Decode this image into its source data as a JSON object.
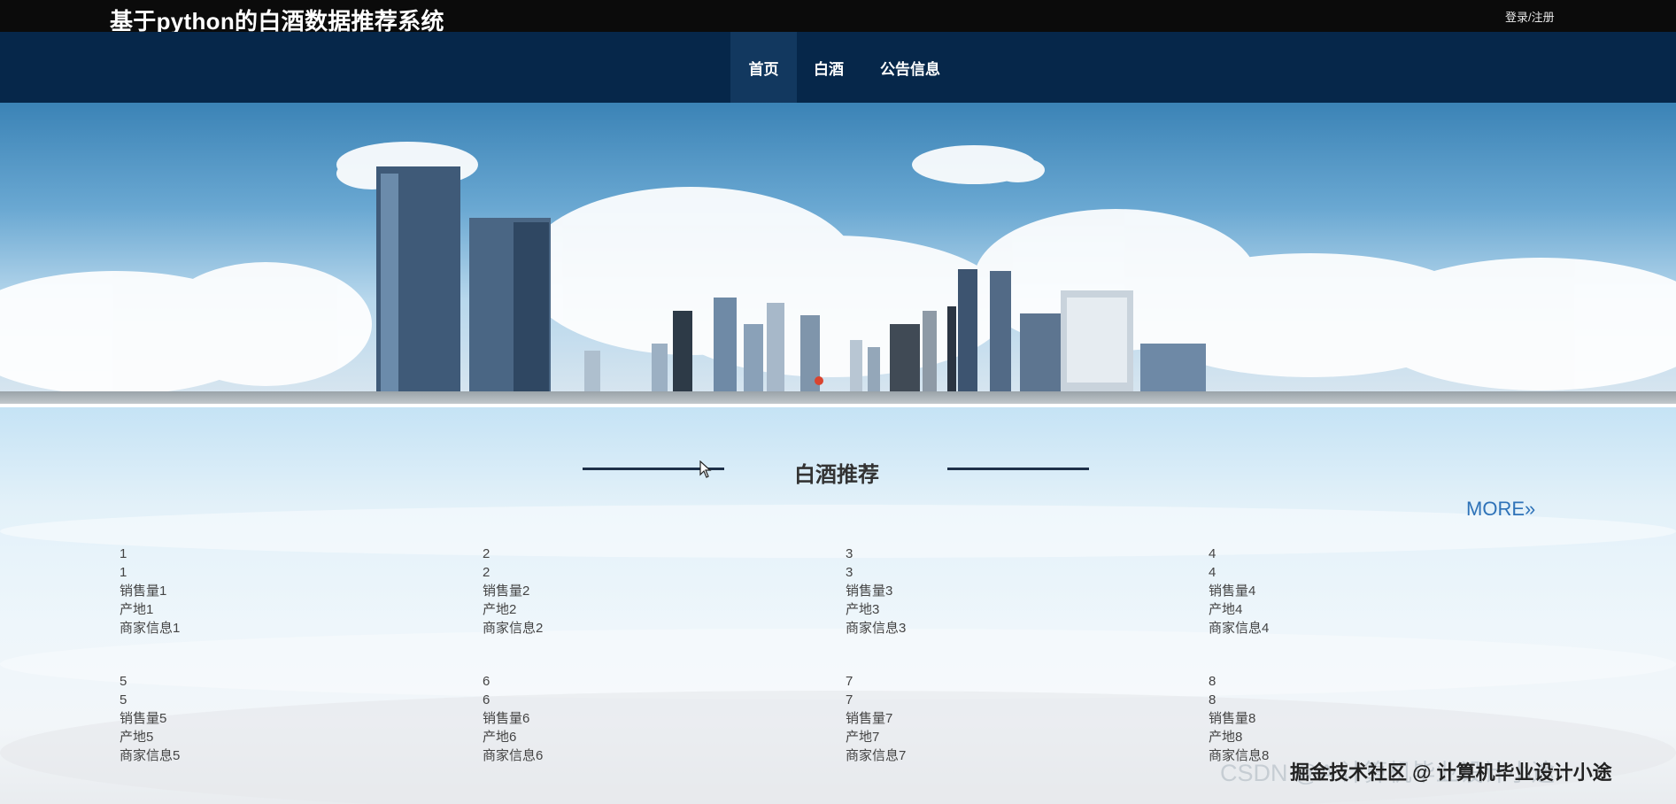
{
  "header": {
    "site_title": "基于python的白酒数据推荐系统",
    "login_link": "登录/注册"
  },
  "nav": {
    "items": [
      {
        "label": "首页",
        "active": true
      },
      {
        "label": "白酒",
        "active": false
      },
      {
        "label": "公告信息",
        "active": false
      }
    ]
  },
  "section": {
    "title": "白酒推荐",
    "more": "MORE»"
  },
  "products": [
    {
      "name": "1",
      "subtitle": "1",
      "sales": "销售量1",
      "origin": "产地1",
      "merchant": "商家信息1"
    },
    {
      "name": "2",
      "subtitle": "2",
      "sales": "销售量2",
      "origin": "产地2",
      "merchant": "商家信息2"
    },
    {
      "name": "3",
      "subtitle": "3",
      "sales": "销售量3",
      "origin": "产地3",
      "merchant": "商家信息3"
    },
    {
      "name": "4",
      "subtitle": "4",
      "sales": "销售量4",
      "origin": "产地4",
      "merchant": "商家信息4"
    },
    {
      "name": "5",
      "subtitle": "5",
      "sales": "销售量5",
      "origin": "产地5",
      "merchant": "商家信息5"
    },
    {
      "name": "6",
      "subtitle": "6",
      "sales": "销售量6",
      "origin": "产地6",
      "merchant": "商家信息6"
    },
    {
      "name": "7",
      "subtitle": "7",
      "sales": "销售量7",
      "origin": "产地7",
      "merchant": "商家信息7"
    },
    {
      "name": "8",
      "subtitle": "8",
      "sales": "销售量8",
      "origin": "产地8",
      "merchant": "商家信息8"
    }
  ],
  "watermark": {
    "text": "掘金技术社区 @ 计算机毕业设计小途",
    "faint": "CSDN @A 计算机毕业设计小途"
  },
  "colors": {
    "topbar": "#0b0b0b",
    "navbar": "#06274a",
    "nav_active": "#12385f",
    "more_link": "#2e72b8"
  }
}
